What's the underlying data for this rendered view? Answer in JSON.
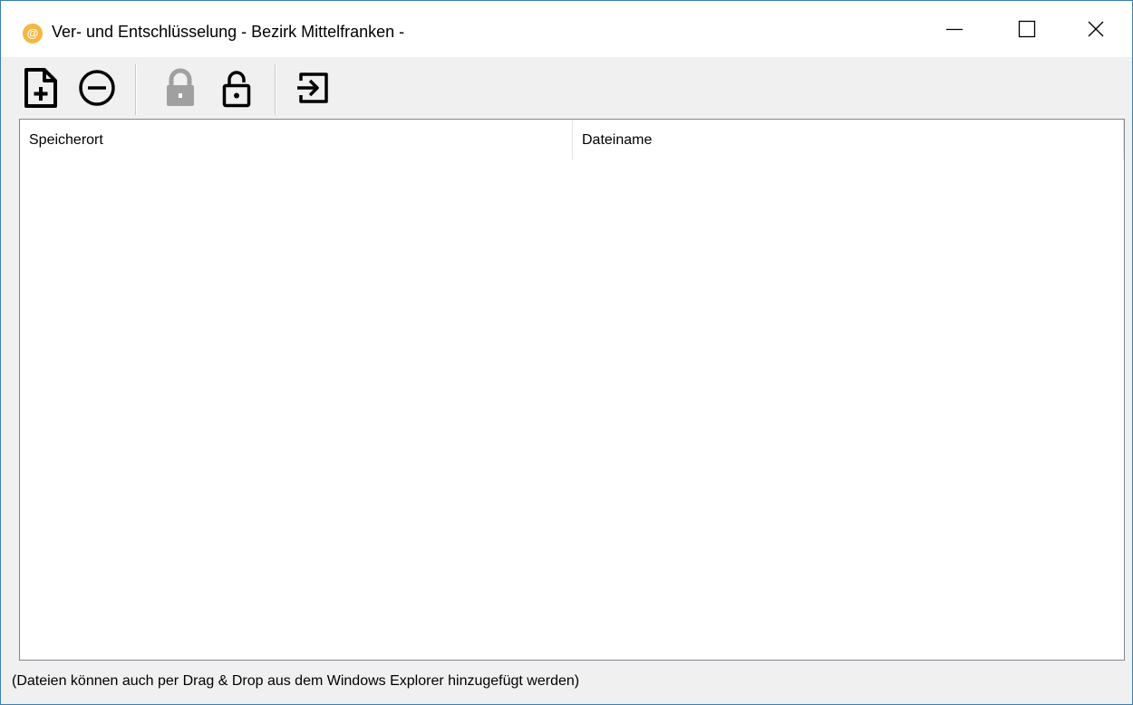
{
  "window": {
    "title": "Ver- und Entschlüsselung - Bezirk Mittelfranken -",
    "app_icon": {
      "name": "at-sign-icon",
      "glyph": "@",
      "color": "#f3b843"
    },
    "controls": {
      "minimize_icon": "minimize-icon",
      "maximize_icon": "maximize-icon",
      "close_icon": "close-icon"
    }
  },
  "toolbar": {
    "buttons": [
      {
        "icon": "add-file-icon",
        "enabled": true
      },
      {
        "icon": "remove-icon",
        "enabled": true
      },
      {
        "icon": "lock-icon",
        "enabled": false
      },
      {
        "icon": "unlock-icon",
        "enabled": true
      },
      {
        "icon": "exit-icon",
        "enabled": true
      }
    ],
    "disabled_color": "#a0a0a0"
  },
  "list": {
    "columns": [
      "Speicherort",
      "Dateiname"
    ],
    "rows": []
  },
  "status": {
    "text": "(Dateien können auch per Drag & Drop aus dem Windows Explorer hinzugefügt werden)"
  }
}
